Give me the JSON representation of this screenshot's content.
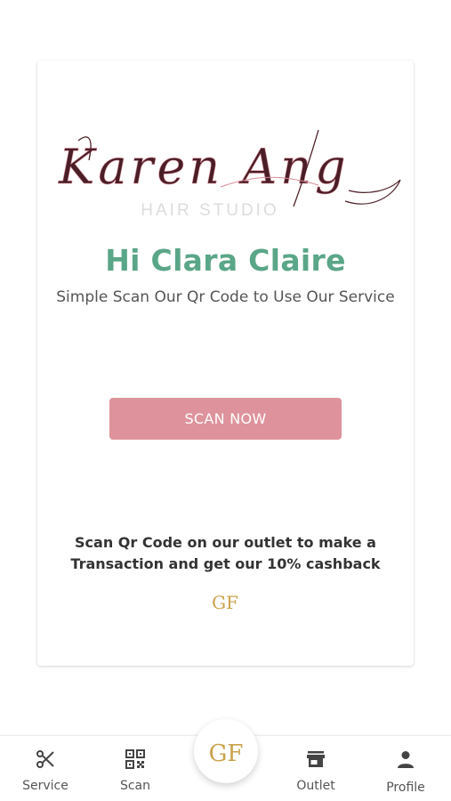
{
  "brand": {
    "script_name": "Karen Ang",
    "studio_label": "HAIR STUDIO"
  },
  "main": {
    "greeting": "Hi Clara Claire",
    "subtitle": "Simple Scan Our Qr Code to Use Our Service",
    "scan_button_label": "SCAN NOW",
    "info_line1": "Scan Qr Code on our outlet to make a",
    "info_line2": "Transaction and get our 10% cashback",
    "partner_logo_text": "GF"
  },
  "nav": {
    "items": [
      {
        "label": "Service",
        "icon": "scissors-icon"
      },
      {
        "label": "Scan",
        "icon": "qr-code-icon"
      },
      {
        "label": "Outlet",
        "icon": "store-icon"
      },
      {
        "label": "Profile",
        "icon": "person-icon"
      }
    ],
    "center_logo_text": "GF"
  },
  "colors": {
    "accent_green": "#5aa688",
    "button_pink": "#de939c",
    "gold": "#c9a24a",
    "logo_maroon": "#4a1e26"
  }
}
